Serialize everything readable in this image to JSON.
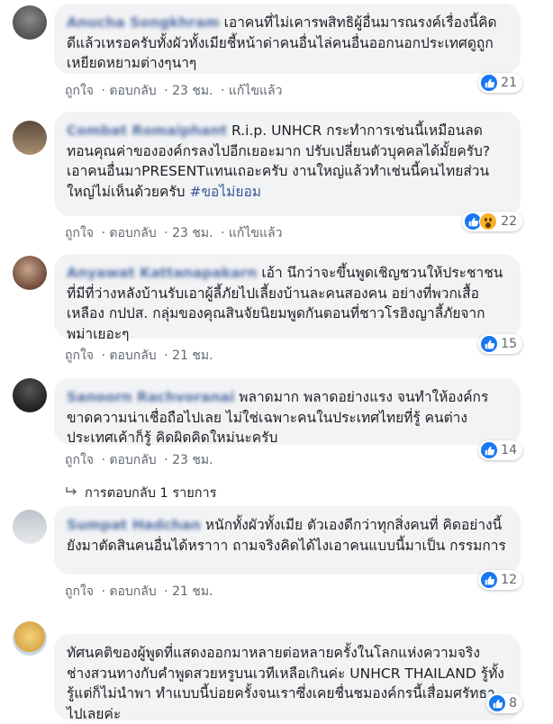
{
  "comments": [
    {
      "author": "Anucha Songkhram",
      "text": "เอาคนที่ไม่เคารพสิทธิผู้อื่นมารณรงค์เรื่องนี้คิดดีแล้วเหรอครับทั้งผัวทั้งเมียชี้หน้าด่าคนอื่นไล่คนอื่นออกนอกประเทศดูถูกเหยียดหยามต่างๆนาๆ",
      "like": "ถูกใจ",
      "reply": "ตอบกลับ",
      "time": "23 ชม.",
      "edited": "แก้ไขแล้ว",
      "reaction_count": "21"
    },
    {
      "author": "Combat Romaiphant",
      "text": "R.i.p. UNHCR กระทำการเช่นนี้เหมือนลดทอนคุณค่าขององค์กรลงไปอีกเยอะมาก ปรับเปลี่ยนตัวบุคคลได้มั้ยครับ? เอาคนอื่นมาPRESENTแทนเถอะครับ งานใหญ่แล้วทำเช่นนี้คนไทยส่วนใหญ่ไม่เห็นด้วยครับ",
      "hashtag": "#ขอไม่ยอม",
      "like": "ถูกใจ",
      "reply": "ตอบกลับ",
      "time": "23 ชม.",
      "edited": "แก้ไขแล้ว",
      "reaction_count": "22"
    },
    {
      "author": "Anyawat Kattanapakarn",
      "text": "เอ้า นึกว่าจะขึ้นพูดเชิญชวนให้ประชาชนที่มีที่ว่างหลังบ้านรับเอาผู้ลี้ภัยไปเลี้ยงบ้านละคนสองคน อย่างที่พวกเสื้อเหลือง กปปส. กลุ่มของคุณสินจัยนิยมพูดกันตอนที่ชาวโรฮิงญาลี้ภัยจากพม่าเยอะๆ",
      "like": "ถูกใจ",
      "reply": "ตอบกลับ",
      "time": "21 ชม.",
      "reaction_count": "15"
    },
    {
      "author": "Sanoorn Rachvoranai",
      "text": "พลาดมาก พลาดอย่างแรง จนทำให้องค์กรขาดความน่าเชื่อถือไปเลย ไม่ใช่เฉพาะคนในประเทศไทยที่รู้ คนต่างประเทศเค้าก็รู้ คิดผิดคิดใหม่นะครับ",
      "like": "ถูกใจ",
      "reply": "ตอบกลับ",
      "time": "23 ชม.",
      "reaction_count": "14",
      "replies_label": "การตอบกลับ 1 รายการ"
    },
    {
      "author": "Sumpat Hadchan",
      "text": "หนักทั้งผัวทั้งเมีย ตัวเองดีกว่าทุกสิ่งคนที่ คิดอย่างนี้ ยังมาตัดสินคนอื่นได้หราาา ถามจริงคิดได้ไงเอาคนแบบนี้มาเป็น กรรมการ",
      "like": "ถูกใจ",
      "reply": "ตอบกลับ",
      "time": "21 ชม.",
      "reaction_count": "12"
    },
    {
      "author": "",
      "text": "ทัศนคติของผู้พูดที่แสดงออกมาหลายต่อหลายครั้งในโลกแห่งความจริง ช่างสวนทางกับคำพูดสวยหรูบนเวทีเหลือเกินค่ะ UNHCR THAILAND รู้ทั้งรู้แต่ก็ไม่นำพา ทำแบบนี้บ่อยครั้งจนเราซึ่งเคยชื่นชมองค์กรนี้เสื่อมศรัทธาไปเลยค่ะ",
      "reaction_count": "8"
    }
  ],
  "colors": {
    "bubble": "#f2f3f5",
    "link": "#385898",
    "meta": "#606770",
    "like_blue": "#1877f2"
  }
}
